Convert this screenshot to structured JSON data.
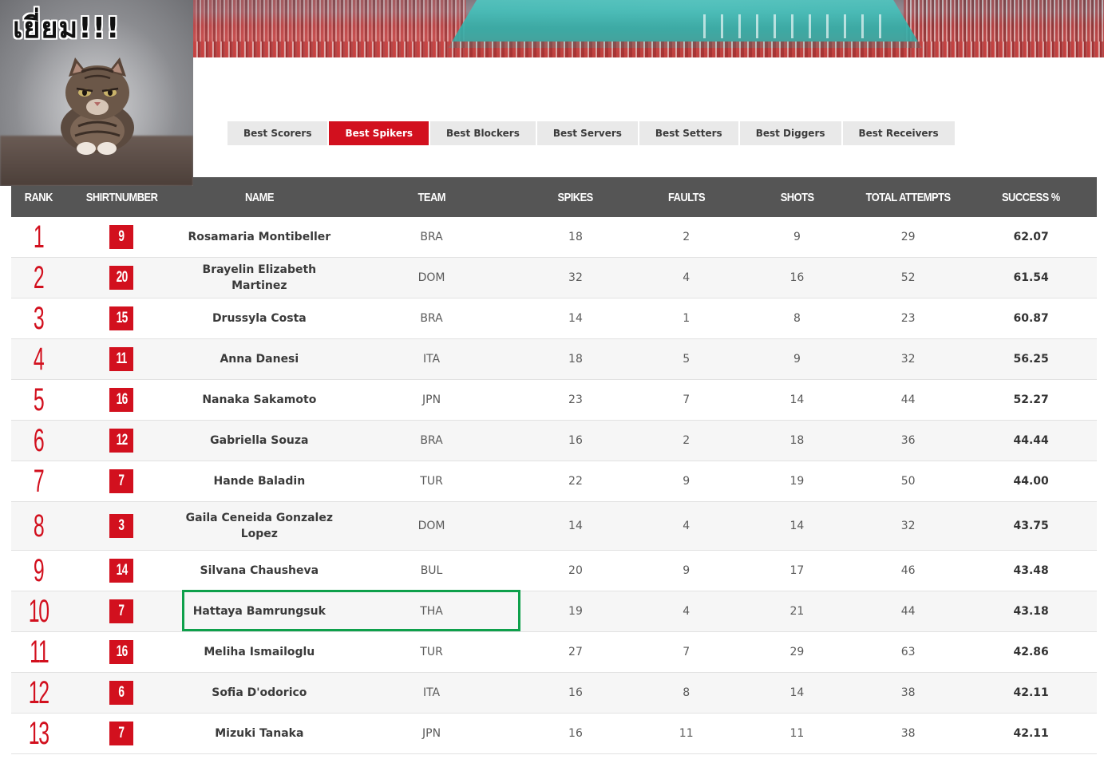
{
  "meme": {
    "caption": "เยี่ยม!!!"
  },
  "tabs": [
    {
      "label": "Best Scorers",
      "active": false
    },
    {
      "label": "Best Spikers",
      "active": true
    },
    {
      "label": "Best Blockers",
      "active": false
    },
    {
      "label": "Best Servers",
      "active": false
    },
    {
      "label": "Best Setters",
      "active": false
    },
    {
      "label": "Best Diggers",
      "active": false
    },
    {
      "label": "Best Receivers",
      "active": false
    }
  ],
  "table": {
    "headers": {
      "rank": "RANK",
      "shirt": "SHIRTNUMBER",
      "name": "NAME",
      "team": "TEAM",
      "spikes": "SPIKES",
      "faults": "FAULTS",
      "shots": "SHOTS",
      "total": "TOTAL ATTEMPTS",
      "success": "SUCCESS %"
    },
    "rows": [
      {
        "rank": "1",
        "shirt": "9",
        "name": "Rosamaria Montibeller",
        "team": "BRA",
        "spikes": "18",
        "faults": "2",
        "shots": "9",
        "total": "29",
        "success": "62.07"
      },
      {
        "rank": "2",
        "shirt": "20",
        "name": "Brayelin Elizabeth Martinez",
        "team": "DOM",
        "spikes": "32",
        "faults": "4",
        "shots": "16",
        "total": "52",
        "success": "61.54"
      },
      {
        "rank": "3",
        "shirt": "15",
        "name": "Drussyla Costa",
        "team": "BRA",
        "spikes": "14",
        "faults": "1",
        "shots": "8",
        "total": "23",
        "success": "60.87"
      },
      {
        "rank": "4",
        "shirt": "11",
        "name": "Anna Danesi",
        "team": "ITA",
        "spikes": "18",
        "faults": "5",
        "shots": "9",
        "total": "32",
        "success": "56.25"
      },
      {
        "rank": "5",
        "shirt": "16",
        "name": "Nanaka Sakamoto",
        "team": "JPN",
        "spikes": "23",
        "faults": "7",
        "shots": "14",
        "total": "44",
        "success": "52.27"
      },
      {
        "rank": "6",
        "shirt": "12",
        "name": "Gabriella Souza",
        "team": "BRA",
        "spikes": "16",
        "faults": "2",
        "shots": "18",
        "total": "36",
        "success": "44.44"
      },
      {
        "rank": "7",
        "shirt": "7",
        "name": "Hande Baladin",
        "team": "TUR",
        "spikes": "22",
        "faults": "9",
        "shots": "19",
        "total": "50",
        "success": "44.00"
      },
      {
        "rank": "8",
        "shirt": "3",
        "name": "Gaila Ceneida Gonzalez Lopez",
        "team": "DOM",
        "spikes": "14",
        "faults": "4",
        "shots": "14",
        "total": "32",
        "success": "43.75"
      },
      {
        "rank": "9",
        "shirt": "14",
        "name": "Silvana Chausheva",
        "team": "BUL",
        "spikes": "20",
        "faults": "9",
        "shots": "17",
        "total": "46",
        "success": "43.48"
      },
      {
        "rank": "10",
        "shirt": "7",
        "name": "Hattaya Bamrungsuk",
        "team": "THA",
        "spikes": "19",
        "faults": "4",
        "shots": "21",
        "total": "44",
        "success": "43.18"
      },
      {
        "rank": "11",
        "shirt": "16",
        "name": "Meliha Ismailoglu",
        "team": "TUR",
        "spikes": "27",
        "faults": "7",
        "shots": "29",
        "total": "63",
        "success": "42.86"
      },
      {
        "rank": "12",
        "shirt": "6",
        "name": "Sofia D'odorico",
        "team": "ITA",
        "spikes": "16",
        "faults": "8",
        "shots": "14",
        "total": "38",
        "success": "42.11"
      },
      {
        "rank": "13",
        "shirt": "7",
        "name": "Mizuki Tanaka",
        "team": "JPN",
        "spikes": "16",
        "faults": "11",
        "shots": "11",
        "total": "38",
        "success": "42.11"
      }
    ]
  },
  "colors": {
    "accent": "#d2101e",
    "header_bg": "#555555",
    "highlight": "#0ea04b"
  }
}
